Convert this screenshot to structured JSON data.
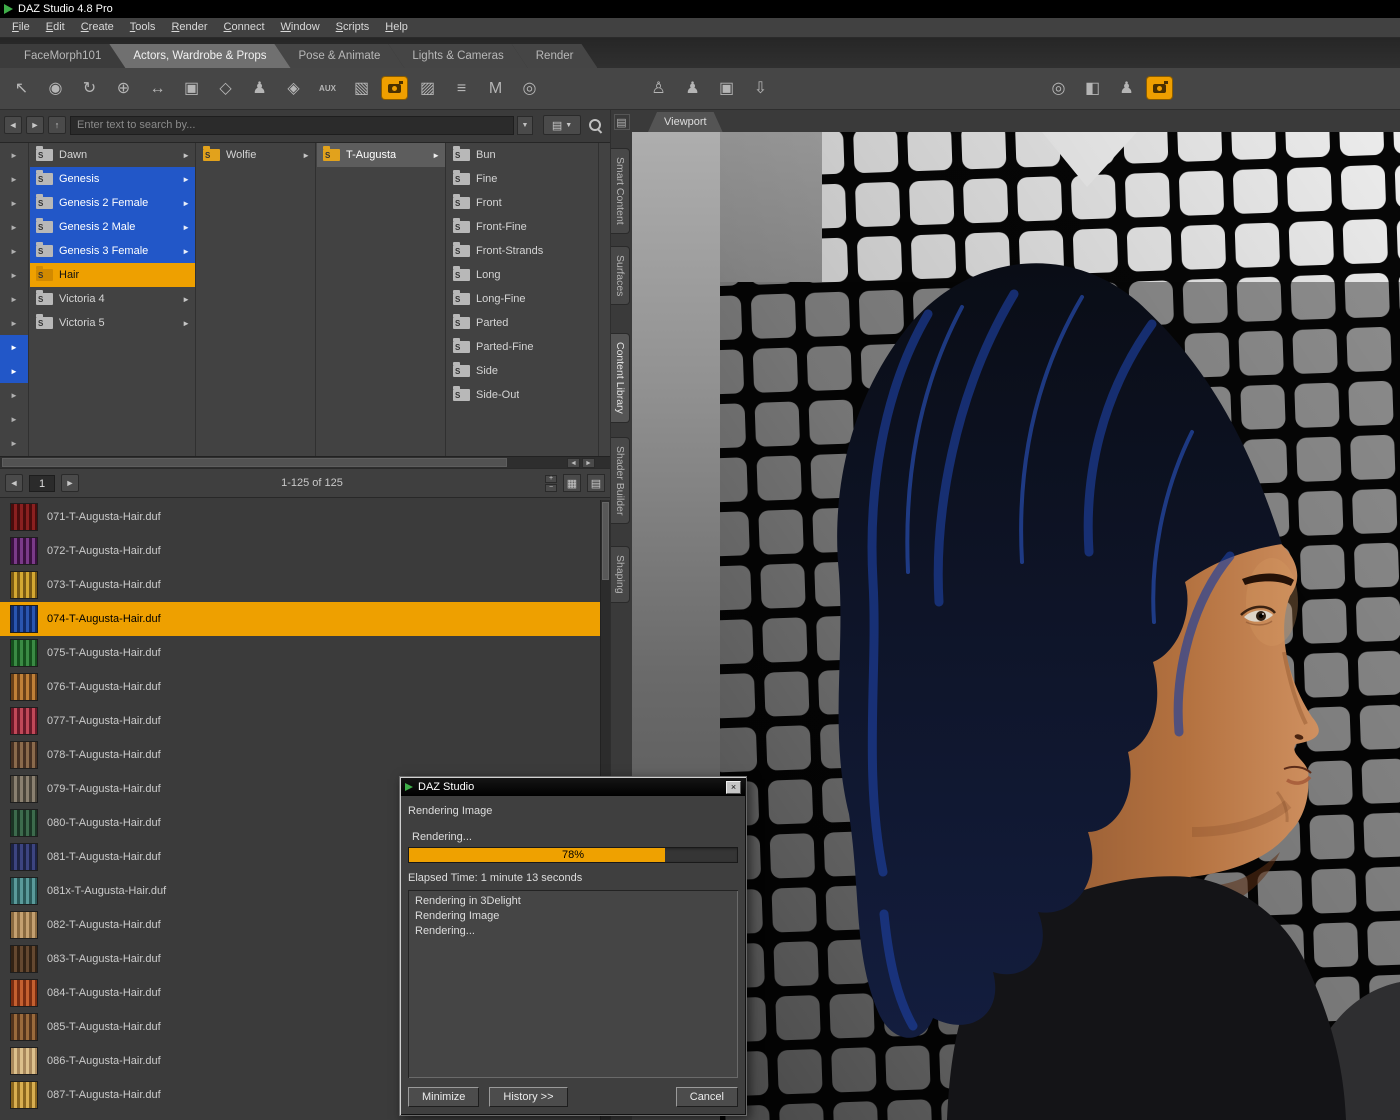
{
  "titlebar": {
    "title": "DAZ Studio 4.8 Pro"
  },
  "menubar": {
    "items": [
      "File",
      "Edit",
      "Create",
      "Tools",
      "Render",
      "Connect",
      "Window",
      "Scripts",
      "Help"
    ]
  },
  "main_tabs": [
    {
      "label": "FaceMorph101",
      "active": false
    },
    {
      "label": "Actors, Wardrobe & Props",
      "active": true
    },
    {
      "label": "Pose & Animate",
      "active": false
    },
    {
      "label": "Lights & Cameras",
      "active": false
    },
    {
      "label": "Render",
      "active": false
    }
  ],
  "icons": {
    "expand": "►",
    "back": "◄",
    "forward": "►",
    "up": "↑",
    "dropdown": "▼",
    "plus": "+",
    "minus": "−",
    "grid_view": "▦",
    "list_view": "▤",
    "layers": "▤",
    "scroll_left": "◄",
    "scroll_right": "►",
    "panel": "▤",
    "close": "×",
    "folder_badge": "S"
  },
  "toolbar": {
    "left": [
      {
        "name": "select-tool-icon",
        "glyph": "↖"
      },
      {
        "name": "surface-select-tool-icon",
        "glyph": "◉"
      },
      {
        "name": "rotate-tool-icon",
        "glyph": "↻"
      },
      {
        "name": "universal-tool-icon",
        "glyph": "⊕"
      },
      {
        "name": "translate-tool-icon",
        "glyph": "↔"
      },
      {
        "name": "scale-tool-icon",
        "glyph": "▣"
      },
      {
        "name": "node-tool-icon",
        "glyph": "◇"
      },
      {
        "name": "figure-tool-icon",
        "glyph": "♟"
      },
      {
        "name": "spot-render-tool-icon",
        "glyph": "◈"
      },
      {
        "name": "aux-viewport-icon",
        "glyph": "AUX",
        "state": "aux"
      },
      {
        "name": "texture-view-icon",
        "glyph": "▧"
      },
      {
        "name": "render-icon",
        "type": "camera"
      },
      {
        "name": "shader-icon",
        "glyph": "▨"
      },
      {
        "name": "settings-icon",
        "glyph": "≡"
      },
      {
        "name": "morphs-icon",
        "glyph": "M"
      },
      {
        "name": "aim-icon",
        "glyph": "◎"
      }
    ],
    "mid": [
      {
        "name": "add-figure-icon",
        "glyph": "♙"
      },
      {
        "name": "wardrobe-icon",
        "glyph": "♟"
      },
      {
        "name": "duplicate-icon",
        "glyph": "▣"
      },
      {
        "name": "transfer-down-icon",
        "glyph": "⇩"
      }
    ],
    "right": [
      {
        "name": "orbit-view-icon",
        "glyph": "◎"
      },
      {
        "name": "cube-view-icon",
        "glyph": "◧"
      },
      {
        "name": "figures-icon",
        "glyph": "♟"
      },
      {
        "name": "quick-render-icon",
        "type": "camera"
      }
    ]
  },
  "search": {
    "placeholder": "Enter text to search by..."
  },
  "tree": {
    "strip": [
      {},
      {},
      {},
      {},
      {},
      {},
      {},
      {},
      {
        "state": "selected"
      },
      {
        "state": "selected"
      },
      {},
      {},
      {}
    ],
    "roots": [
      {
        "label": "Dawn",
        "arrow": true
      },
      {
        "label": "Genesis",
        "selected": true,
        "arrow": true
      },
      {
        "label": "Genesis 2 Female",
        "selected": true,
        "arrow": true
      },
      {
        "label": "Genesis 2 Male",
        "selected": true,
        "arrow": true
      },
      {
        "label": "Genesis 3 Female",
        "selected": true,
        "arrow": true
      },
      {
        "label": "Hair",
        "state": "highlighted",
        "arrow": false
      },
      {
        "label": "Victoria 4",
        "arrow": true
      },
      {
        "label": "Victoria 5",
        "arrow": true
      }
    ],
    "level2": [
      {
        "label": "Wolfie",
        "state": "orange",
        "arrow": true
      }
    ],
    "level3": [
      {
        "label": "T-Augusta",
        "state": "current",
        "arrow": true
      }
    ],
    "level4": [
      "Bun",
      "Fine",
      "Front",
      "Front-Fine",
      "Front-Strands",
      "Long",
      "Long-Fine",
      "Parted",
      "Parted-Fine",
      "Side",
      "Side-Out"
    ]
  },
  "pagination": {
    "page": "1",
    "range_label": "1-125 of 125"
  },
  "files": [
    {
      "label": "071-T-Augusta-Hair.duf",
      "thumb": [
        "#4a0c0c",
        "#8a2020"
      ]
    },
    {
      "label": "072-T-Augusta-Hair.duf",
      "thumb": [
        "#3a1040",
        "#7a3a88"
      ]
    },
    {
      "label": "073-T-Augusta-Hair.duf",
      "thumb": [
        "#7a5a14",
        "#d4a832"
      ]
    },
    {
      "label": "074-T-Augusta-Hair.duf",
      "thumb": [
        "#102a6a",
        "#2a55b0"
      ],
      "selected": true
    },
    {
      "label": "075-T-Augusta-Hair.duf",
      "thumb": [
        "#14501c",
        "#3a8a44"
      ]
    },
    {
      "label": "076-T-Augusta-Hair.duf",
      "thumb": [
        "#6a4018",
        "#c08038"
      ]
    },
    {
      "label": "077-T-Augusta-Hair.duf",
      "thumb": [
        "#6a1828",
        "#c04858"
      ]
    },
    {
      "label": "078-T-Augusta-Hair.duf",
      "thumb": [
        "#463022",
        "#8a6a4c"
      ]
    },
    {
      "label": "079-T-Augusta-Hair.duf",
      "thumb": [
        "#4a443a",
        "#8a8070"
      ]
    },
    {
      "label": "080-T-Augusta-Hair.duf",
      "thumb": [
        "#1a3424",
        "#3c6a4c"
      ]
    },
    {
      "label": "081-T-Augusta-Hair.duf",
      "thumb": [
        "#1c2244",
        "#3c4480"
      ]
    },
    {
      "label": "081x-T-Augusta-Hair.duf",
      "thumb": [
        "#2a5a5a",
        "#5a9a9a"
      ]
    },
    {
      "label": "082-T-Augusta-Hair.duf",
      "thumb": [
        "#8a6a40",
        "#c4a070"
      ]
    },
    {
      "label": "083-T-Augusta-Hair.duf",
      "thumb": [
        "#322214",
        "#644830"
      ]
    },
    {
      "label": "084-T-Augusta-Hair.duf",
      "thumb": [
        "#7a2c10",
        "#c46030"
      ]
    },
    {
      "label": "085-T-Augusta-Hair.duf",
      "thumb": [
        "#54341c",
        "#9a6a3c"
      ]
    },
    {
      "label": "086-T-Augusta-Hair.duf",
      "thumb": [
        "#a8885c",
        "#dcc08c"
      ]
    },
    {
      "label": "087-T-Augusta-Hair.duf",
      "thumb": [
        "#8a661e",
        "#d8ae50"
      ]
    }
  ],
  "side_tabs": [
    {
      "label": "Smart Content"
    },
    {
      "label": "Surfaces"
    },
    {
      "label": "Content Library",
      "active": true
    },
    {
      "label": "Shader Builder"
    },
    {
      "label": "Shaping"
    }
  ],
  "viewport": {
    "tab_label": "Viewport"
  },
  "dialog": {
    "title": "DAZ Studio",
    "heading": "Rendering Image",
    "status": "Rendering...",
    "progress_pct": 78,
    "progress_label": "78%",
    "elapsed": "Elapsed Time:  1 minute 13 seconds",
    "log": [
      "Rendering in 3Delight",
      "Rendering Image",
      "Rendering..."
    ],
    "buttons": {
      "minimize": "Minimize",
      "history": "History >>",
      "cancel": "Cancel"
    }
  }
}
